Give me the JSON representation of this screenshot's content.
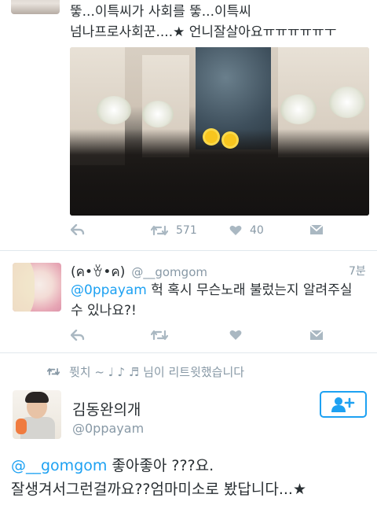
{
  "tweet1": {
    "text_line1": "뚷...이특씨가 사회를 뚷...이특씨",
    "text_line2": "넘나프로사회꾼....★ 언니잘살아요ㅠㅠㅠㅠㅠㅜ",
    "actions": {
      "retweets": "571",
      "likes": "40"
    }
  },
  "reply": {
    "display_name": "(ค•ꈊ•ค)",
    "handle": "@__gomgom",
    "time": "7분",
    "mention": "@0ppayam",
    "text_line1": " 헉 혹시 무슨노래 불렀는지 알려주실",
    "text_line2": "수 있나요?!"
  },
  "retweet_context": {
    "text": "퓟치 ~ ♩ ♪ ♬ 님이 리트윗했습니다"
  },
  "main_tweet": {
    "display_name": "김동완의개",
    "handle": "@0ppayam",
    "mention": "@__gomgom",
    "text_line1_rest": " 좋아좋아 ???요.",
    "text_line2": "잘생겨서그런걸까요??엄마미소로 봤답니다...★"
  },
  "colors": {
    "accent": "#1da1f2",
    "muted": "#8899a6",
    "icon": "#aab8c2",
    "divider": "#e1e8ed"
  }
}
